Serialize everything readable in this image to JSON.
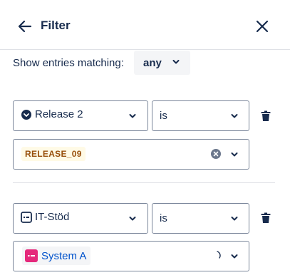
{
  "header": {
    "title": "Filter"
  },
  "match": {
    "label": "Show entries matching:",
    "value": "any"
  },
  "rules": [
    {
      "field": "Release 2",
      "field_icon": "check-circle-icon",
      "operator": "is",
      "value_lozenge": "RELEASE_09"
    },
    {
      "field": "IT-Stöd",
      "field_icon": "component-icon",
      "operator": "is",
      "value_tag": "System A",
      "value_tag_icon": "component-tag-icon"
    }
  ],
  "colors": {
    "text": "#172b4d",
    "border": "#7a869a",
    "lozenge_bg": "#fffae6",
    "lozenge_text": "#974f0c",
    "tag_icon": "#e5297b",
    "tag_text": "#0052cc"
  }
}
